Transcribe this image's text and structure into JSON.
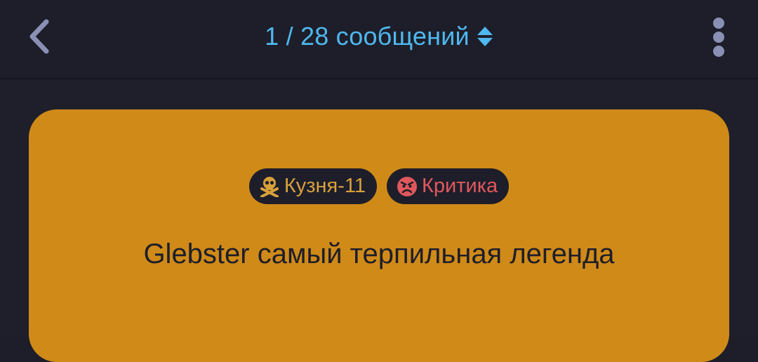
{
  "header": {
    "back_icon": "chevron-left-icon",
    "title": "1 / 28 сообщений",
    "sort_icon": "sort-up-down-icon",
    "more_icon": "more-vertical-icon"
  },
  "card": {
    "author_badge": {
      "icon": "skull-crossbones-icon",
      "label": "Кузня-11"
    },
    "tag_badge": {
      "icon": "angry-face-icon",
      "label": "Критика"
    },
    "message": "Glebster самый терпильная легенда"
  },
  "colors": {
    "background": "#1d1e2a",
    "accent_blue": "#4fb8ee",
    "card": "#d08a18",
    "author_badge_text": "#d8a03a",
    "tag_badge_text": "#e0585c"
  }
}
